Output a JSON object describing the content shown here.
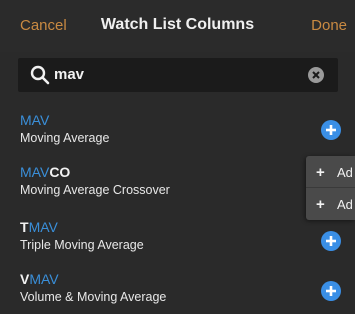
{
  "header": {
    "cancel_label": "Cancel",
    "title": "Watch List Columns",
    "done_label": "Done"
  },
  "search": {
    "value": "mav"
  },
  "results": [
    {
      "prefix": "",
      "match": "MAV",
      "suffix": "",
      "description": "Moving Average"
    },
    {
      "prefix": "",
      "match": "MAV",
      "suffix": "CO",
      "description": "Moving Average Crossover"
    },
    {
      "prefix": "T",
      "match": "MAV",
      "suffix": "",
      "description": "Triple Moving Average"
    },
    {
      "prefix": "V",
      "match": "MAV",
      "suffix": "",
      "description": "Volume & Moving Average"
    }
  ],
  "add_menu": {
    "items": [
      {
        "label": "Ad"
      },
      {
        "label": "Ad"
      }
    ]
  },
  "colors": {
    "accent": "#c98a42",
    "highlight": "#3a8fd9",
    "add_button": "#3a8fe6",
    "background": "#2a2a2a"
  }
}
